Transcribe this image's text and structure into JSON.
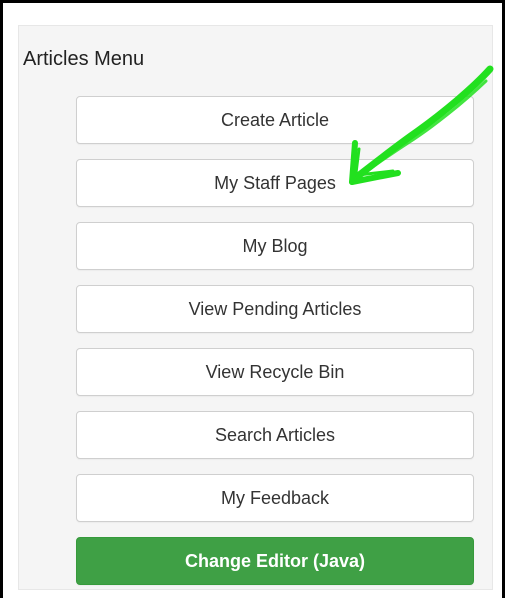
{
  "menu": {
    "title": "Articles Menu",
    "items": [
      {
        "label": "Create Article"
      },
      {
        "label": "My Staff Pages"
      },
      {
        "label": "My Blog"
      },
      {
        "label": "View Pending Articles"
      },
      {
        "label": "View Recycle Bin"
      },
      {
        "label": "Search Articles"
      },
      {
        "label": "My Feedback"
      },
      {
        "label": "Change Editor (Java)"
      }
    ]
  },
  "colors": {
    "primary_button": "#3fa045",
    "annotation_arrow": "#22e01f"
  },
  "icons": [
    "annotation-arrow-icon"
  ]
}
